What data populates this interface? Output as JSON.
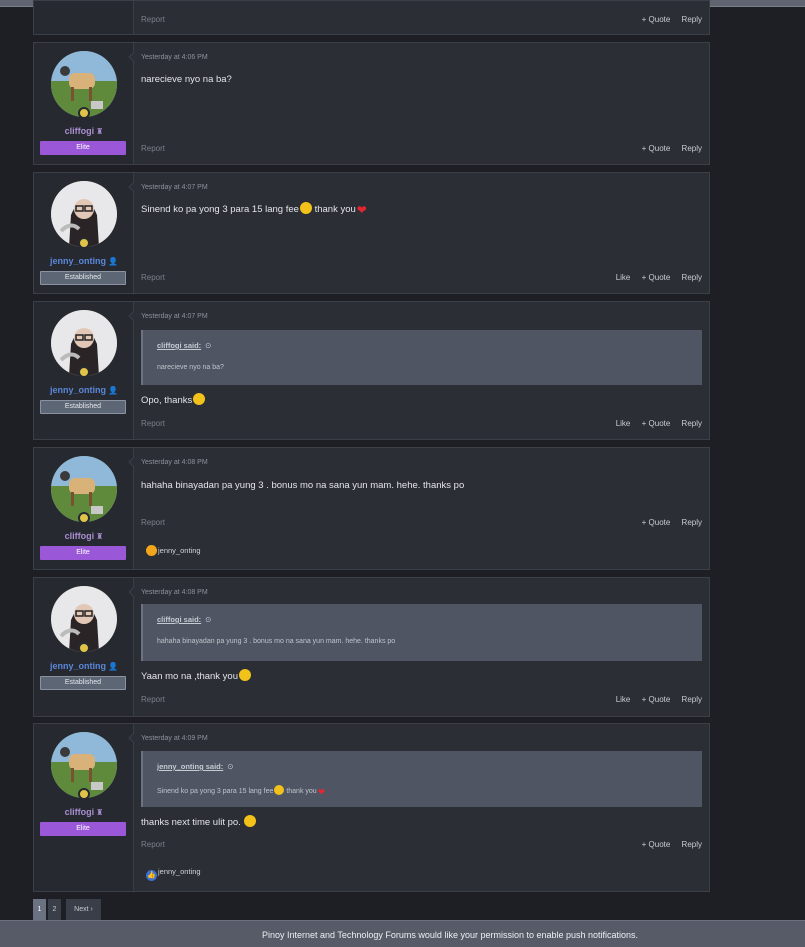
{
  "top_post": {
    "report": "Report",
    "quote": "+ Quote",
    "reply": "Reply"
  },
  "posts": [
    {
      "time": "Yesterday at 4:06 PM",
      "user": "cliffogi",
      "rank": "Elite",
      "message": "narecieve nyo na ba?",
      "report": "Report",
      "quote": "+ Quote",
      "reply": "Reply"
    },
    {
      "time": "Yesterday at 4:07 PM",
      "user": "jenny_onting",
      "rank": "Established",
      "message": "Sinend ko pa yong 3 para 15 lang fee",
      "message_tail": "thank you",
      "report": "Report",
      "like": "Like",
      "quote": "+ Quote",
      "reply": "Reply"
    },
    {
      "time": "Yesterday at 4:07 PM",
      "user": "jenny_onting",
      "rank": "Established",
      "quote_author": "cliffogi said:",
      "quote_text": "narecieve nyo na ba?",
      "message": "Opo, thanks",
      "report": "Report",
      "like": "Like",
      "quote": "+ Quote",
      "reply": "Reply"
    },
    {
      "time": "Yesterday at 4:08 PM",
      "user": "cliffogi",
      "rank": "Elite",
      "message": "hahaha binayadan pa yung 3 . bonus mo na sana yun mam. hehe. thanks po",
      "report": "Report",
      "quote": "+ Quote",
      "reply": "Reply",
      "reaction_user": "jenny_onting"
    },
    {
      "time": "Yesterday at 4:08 PM",
      "user": "jenny_onting",
      "rank": "Established",
      "quote_author": "cliffogi said:",
      "quote_text": "hahaha binayadan pa yung 3 . bonus mo na sana yun mam. hehe. thanks po",
      "message": "Yaan mo na ,thank you",
      "report": "Report",
      "like": "Like",
      "quote": "+ Quote",
      "reply": "Reply"
    },
    {
      "time": "Yesterday at 4:09 PM",
      "user": "cliffogi",
      "rank": "Elite",
      "quote_author": "jenny_onting said:",
      "quote_text": "Sinend ko pa yong 3 para 15 lang fee",
      "quote_tail": "thank you",
      "message": "thanks next time ulit po.",
      "report": "Report",
      "quote": "+ Quote",
      "reply": "Reply",
      "reaction_user": "jenny_onting"
    }
  ],
  "pagination": {
    "page1": "1",
    "page2": "2",
    "next": "Next ›"
  },
  "push_notice": "Pinoy Internet and Technology Forums would like your permission to enable push notifications.",
  "colors": {
    "elite": "#9a58d8",
    "established": "#5d6675",
    "background": "#1d1f24",
    "post_bg": "#2b2e35"
  },
  "icons": {
    "quote_arrow": "circle-arrow-icon",
    "emoji": "grinning-emoji-icon",
    "heart": "heart-icon",
    "love_reaction": "heart-eyes-reaction-icon",
    "like_reaction": "thumbs-up-reaction-icon"
  }
}
